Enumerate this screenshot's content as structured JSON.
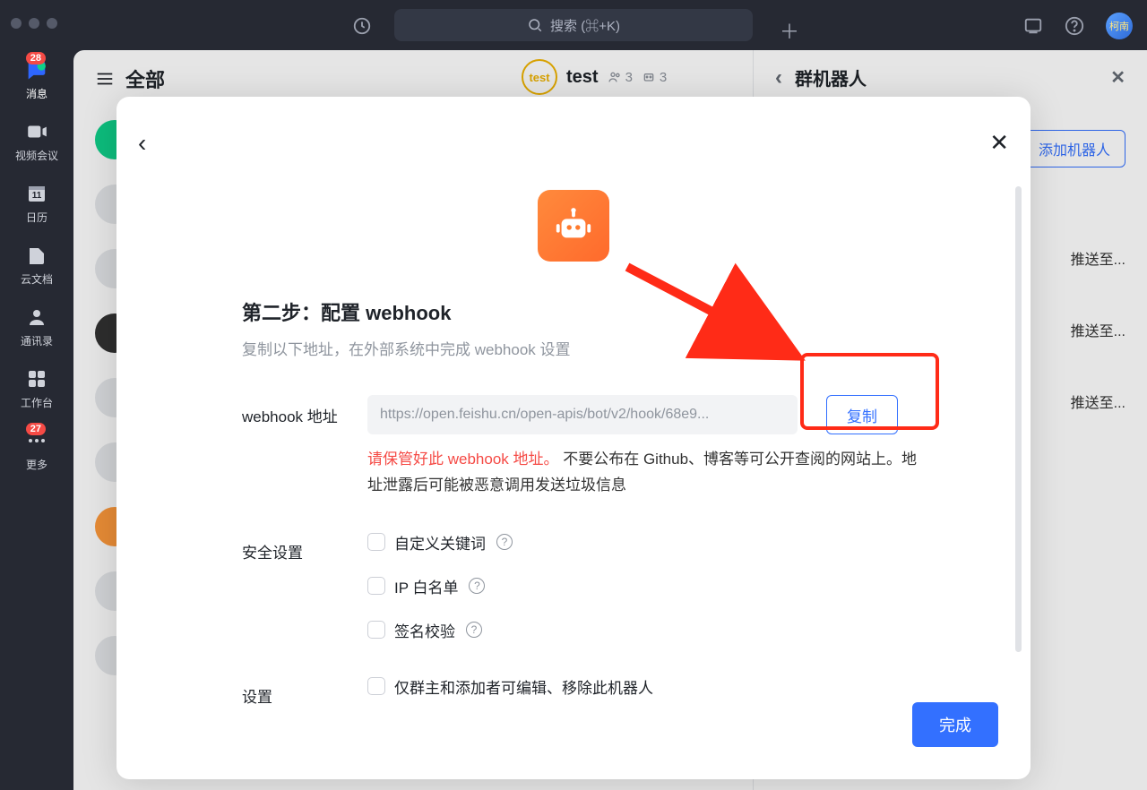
{
  "titlebar": {
    "search_placeholder": "搜索 (⌘+K)",
    "avatar_text": "柯南"
  },
  "leftnav": {
    "items": [
      {
        "label": "消息",
        "badge": 28
      },
      {
        "label": "视频会议"
      },
      {
        "label": "日历"
      },
      {
        "label": "云文档"
      },
      {
        "label": "通讯录"
      },
      {
        "label": "工作台"
      },
      {
        "label": "更多",
        "badge": 27
      }
    ]
  },
  "chat_list": {
    "header_label": "全部"
  },
  "conversation": {
    "title": "test",
    "member_count": "3",
    "bot_count": "3"
  },
  "right_panel": {
    "title": "群机器人",
    "add_button": "添加机器人",
    "push_suffix": "推送至..."
  },
  "modal": {
    "step_title": "第二步：配置 webhook",
    "step_desc": "复制以下地址，在外部系统中完成 webhook 设置",
    "url_label": "webhook 地址",
    "url_value": "https://open.feishu.cn/open-apis/bot/v2/hook/68e9...",
    "copy_button": "复制",
    "warn_red": "请保管好此 webhook 地址。",
    "warn_black": "不要公布在 Github、博客等可公开查阅的网站上。地址泄露后可能被恶意调用发送垃圾信息",
    "security_label": "安全设置",
    "security_options": {
      "keyword": "自定义关键词",
      "ip_whitelist": "IP 白名单",
      "signature": "签名校验"
    },
    "settings_label": "设置",
    "settings_option": "仅群主和添加者可编辑、移除此机器人",
    "done_button": "完成"
  }
}
